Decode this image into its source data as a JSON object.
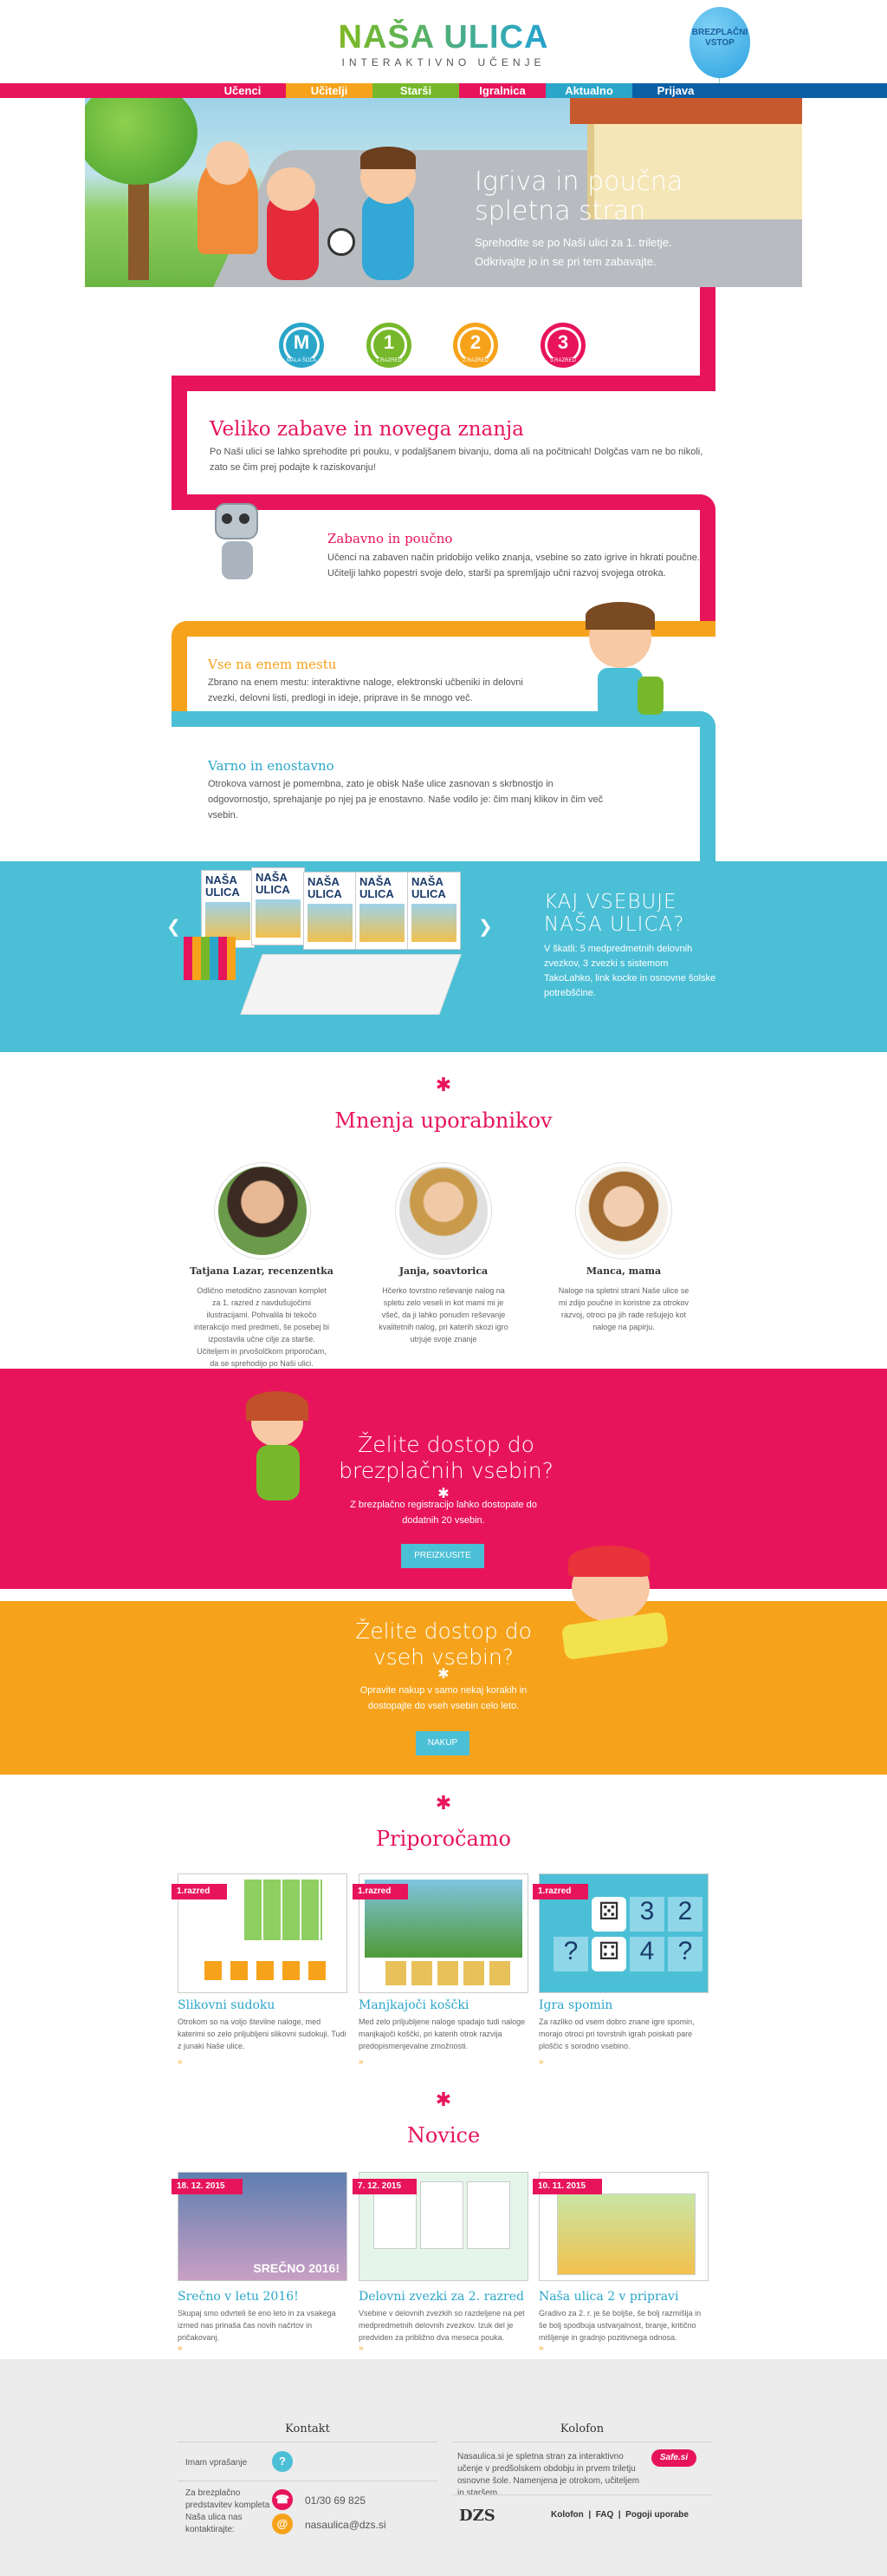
{
  "header": {
    "logo_title": "NAŠA ULICA",
    "logo_subtitle": "INTERAKTIVNO UČENJE",
    "balloon": "BREZPLAČNI VSTOP"
  },
  "nav": {
    "items": [
      {
        "label": "Učenci",
        "color": "#e8145b"
      },
      {
        "label": "Učitelji",
        "color": "#f6a31b"
      },
      {
        "label": "Starši",
        "color": "#76b82a"
      },
      {
        "label": "Igralnica",
        "color": "#e8145b"
      },
      {
        "label": "Aktualno",
        "color": "#2aa6c9"
      },
      {
        "label": "Prijava",
        "color": "#0b5fa5"
      }
    ]
  },
  "hero": {
    "title": "Igriva in poučna spletna stran",
    "subtitle": "Sprehodite se po Naši ulici za 1. triletje. Odkrivajte jo in se pri tem zabavajte."
  },
  "grades": [
    {
      "label": "M",
      "sub": "MALA ŠOLA",
      "color": "#2aa6c9"
    },
    {
      "label": "1",
      "sub": "1.RAZRED",
      "color": "#76b82a"
    },
    {
      "label": "2",
      "sub": "2.RAZRED",
      "color": "#f6a31b"
    },
    {
      "label": "3",
      "sub": "3.RAZRED",
      "color": "#e8145b"
    }
  ],
  "intro": {
    "title": "Veliko zabave in novega znanja",
    "text": "Po Naši ulici se lahko sprehodite pri pouku, v podaljšanem bivanju, doma ali na počitnicah! Dolgčas vam ne bo nikoli, zato se čim prej podajte k raziskovanju!"
  },
  "features": [
    {
      "title": "Zabavno in poučno",
      "text": "Učenci na zabaven način pridobijo veliko znanja, vsebine so zato igrive in hkrati poučne. Učitelji lahko popestri svoje delo, starši pa spremljajo učni razvoj svojega otroka.",
      "color": "#e8145b"
    },
    {
      "title": "Vse na enem mestu",
      "text": "Zbrano na enem mestu: interaktivne naloge, elektronski učbeniki in delovni zvezki, delovni listi, predlogi in ideje, priprave in še mnogo več.",
      "color": "#f6a31b"
    },
    {
      "title": "Varno in enostavno",
      "text": "Otrokova varnost je pomembna, zato je obisk Naše ulice zasnovan s skrbnostjo in odgovornostjo, sprehajanje po njej pa je enostavno. Naše vodilo je: čim manj klikov in čim več vsebin.",
      "color": "#2aa6c9"
    }
  ],
  "kit": {
    "title": "KAJ VSEBUJE NAŠA ULICA?",
    "text": "V škatli: 5 medpredmetnih delovnih zvezkov, 3 zvezki s sistemom TakoLahko, link kocke in osnovne šolske potrebščine.",
    "book_title": "NAŠA ULICA"
  },
  "testimonials": {
    "title": "Mnenja uporabnikov",
    "items": [
      {
        "name": "Tatjana Lazar, recenzentka",
        "text": "Odlično metodično zasnovan komplet za 1. razred z navdušujočimi ilustracijami. Pohvalila bi tekočo interakcijo med predmeti, še posebej bi izpostavila učne cilje za starše. Učiteljem in prvošolčkom priporočam, da se sprehodijo po Naši ulici."
      },
      {
        "name": "Janja, soavtorica",
        "text": "Hčerko tovrstno reševanje nalog na spletu zelo veseli in kot mami mi je všeč, da ji lahko ponudim reševanje kvalitetnih nalog, pri katerih skozi igro utrjuje svoje znanje"
      },
      {
        "name": "Manca, mama",
        "text": "Naloge na spletni strani Naše ulice se mi zdijo poučne in koristne za otrokov razvoj, otroci pa jih rade rešujejo kot naloge na papirju."
      }
    ]
  },
  "free": {
    "title": "Želite dostop do brezplačnih vsebin?",
    "text": "Z brezplačno registracijo lahko dostopate do dodatnih 20 vsebin.",
    "button": "PREIZKUSITE"
  },
  "paid": {
    "title": "Želite dostop do vseh vsebin?",
    "text": "Opravite nakup v samo nekaj korakih in dostopajte do vseh vsebin celo leto.",
    "button": "NAKUP"
  },
  "recommend": {
    "title": "Priporočamo",
    "items": [
      {
        "badge": "1.razred",
        "title": "Slikovni sudoku",
        "text": "Otrokom so na voljo številne naloge, med katerimi so zelo priljubljeni slikovni sudokuji. Tudi z junaki Naše ulice."
      },
      {
        "badge": "1.razred",
        "title": "Manjkajoči koščki",
        "text": "Med zelo priljubljene naloge spadajo tudi naloge manjkajoči koščki, pri katerih otrok razvija predopismenjevalne zmožnosti."
      },
      {
        "badge": "1.razred",
        "title": "Igra spomin",
        "text": "Za razliko od vsem dobro znane igre spomin, morajo otroci pri tovrstnih igrah poiskati pare ploščic s sorodno vsebino."
      }
    ],
    "numbers": [
      "3",
      "2",
      "?",
      "4",
      "?"
    ]
  },
  "news": {
    "title": "Novice",
    "banner": "SREČNO 2016!",
    "items": [
      {
        "date": "18. 12. 2015",
        "title": "Srečno v letu 2016!",
        "text": "Skupaj smo odvrteli še eno leto in za vsakega izmed nas prinaša čas novih načrtov in pričakovanj."
      },
      {
        "date": "7. 12. 2015",
        "title": "Delovni zvezki za 2. razred",
        "text": "Vsebine v delovnih zvezkih so razdeljene na pet medpredmetnih delovnih zvezkov. Izuk del je predviden za približno dva meseca pouka."
      },
      {
        "date": "10. 11. 2015",
        "title": "Naša ulica 2 v pripravi",
        "text": "Gradivo za 2. r. je še boljše, še bolj razmišlja in še bolj spodbuja ustvarjalnost, branje, kritično mišljenje in gradnjo pozitivnega odnosa."
      }
    ]
  },
  "footer": {
    "contact_title": "Kontakt",
    "colophon_title": "Kolofon",
    "question_label": "Imam vprašanje",
    "reps_label": "Za brezplačno predstavitev kompleta Naša ulica nas kontaktirajte:",
    "phone": "01/30 69 825",
    "email": "nasaulica@dzs.si",
    "about": "Nasaulica.si je spletna stran za interaktivno učenje v predšolskem obdobju in prvem triletju osnovne šole. Namenjena je otrokom, učiteljem in staršem.",
    "safe": "Safe.si",
    "publisher": "DZS",
    "links": [
      "Kolofon",
      "FAQ",
      "Pogoji uporabe"
    ]
  }
}
